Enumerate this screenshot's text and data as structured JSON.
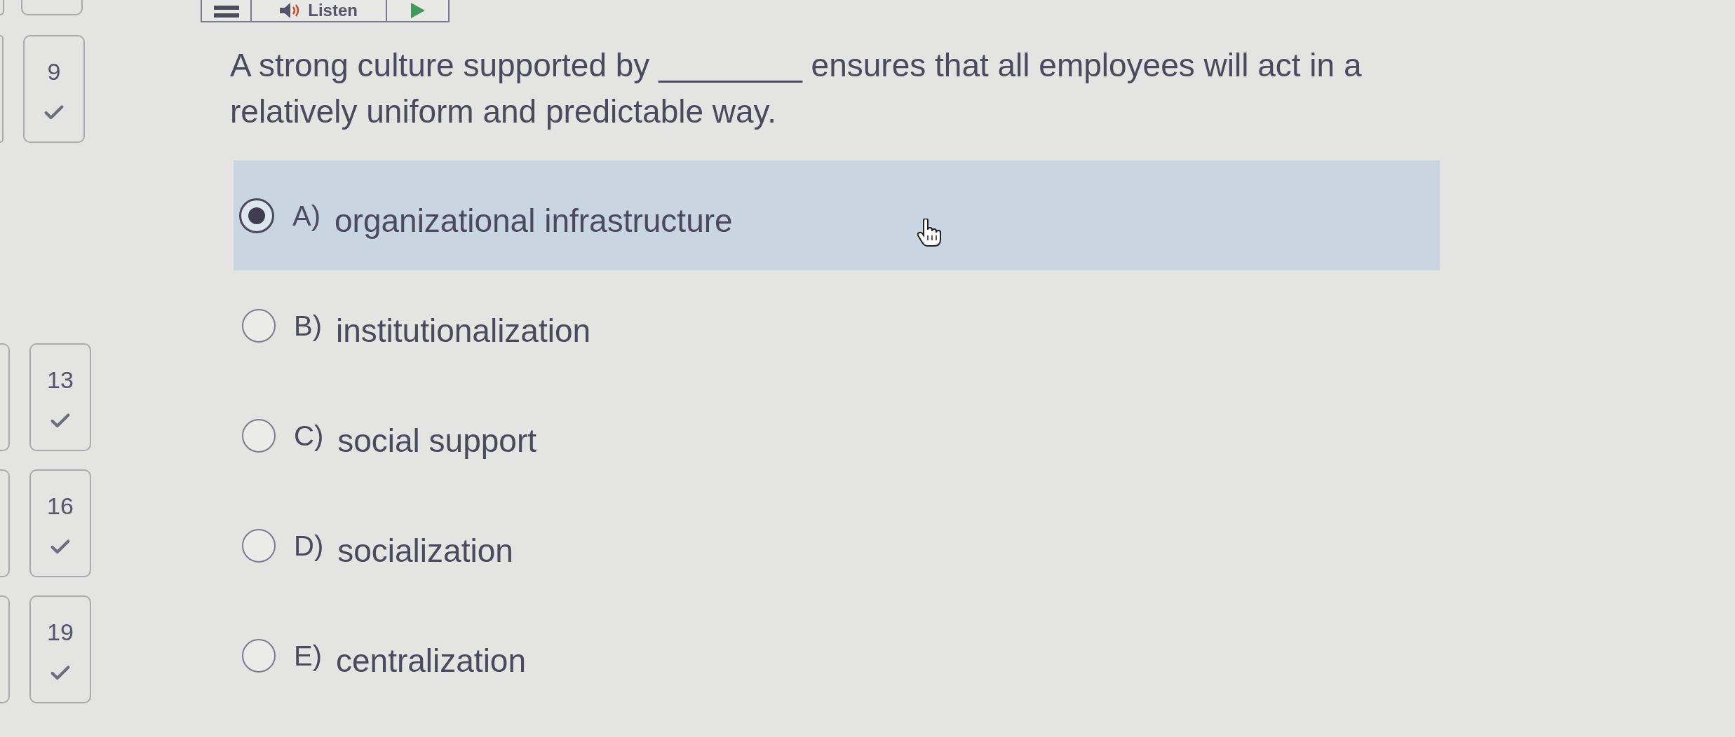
{
  "toolbar": {
    "buttons": [
      {
        "kind": "menu"
      },
      {
        "kind": "listen",
        "label": "Listen"
      },
      {
        "kind": "play"
      }
    ]
  },
  "sidebar": {
    "tiles": [
      {
        "number": "9",
        "answered": true
      },
      {
        "number": "13",
        "answered": true
      },
      {
        "number": "16",
        "answered": true
      },
      {
        "number": "19",
        "answered": true
      }
    ]
  },
  "question": {
    "text": "A strong culture supported by ________ ensures that all employees will act in a relatively uniform and predictable way."
  },
  "options": [
    {
      "letter": "A)",
      "text": "organizational infrastructure",
      "selected": true
    },
    {
      "letter": "B)",
      "text": "institutionalization",
      "selected": false
    },
    {
      "letter": "C)",
      "text": "social support",
      "selected": false
    },
    {
      "letter": "D)",
      "text": "socialization",
      "selected": false
    },
    {
      "letter": "E)",
      "text": "centralization",
      "selected": false
    }
  ]
}
